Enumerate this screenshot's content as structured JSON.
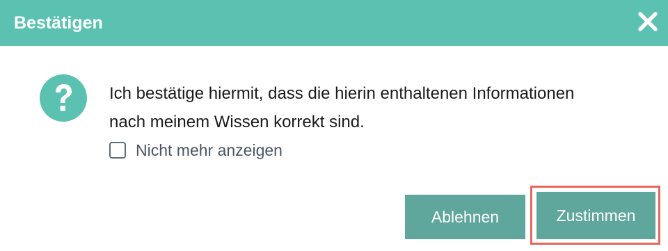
{
  "dialog": {
    "title": "Bestätigen",
    "message_line1": "Ich bestätige hiermit, dass die hierin enthaltenen Informationen",
    "message_line2": "nach meinem Wissen korrekt sind.",
    "dont_show_again_label": "Nicht mehr anzeigen",
    "dont_show_again_checked": false,
    "reject_label": "Ablehnen",
    "accept_label": "Zustimmen",
    "icons": {
      "close": "close-icon",
      "question": "question-icon"
    }
  },
  "colors": {
    "header": "#5bc2b1",
    "button": "#5fa79c",
    "highlight_border": "#e8665b",
    "icon": "#5bc2b1"
  }
}
